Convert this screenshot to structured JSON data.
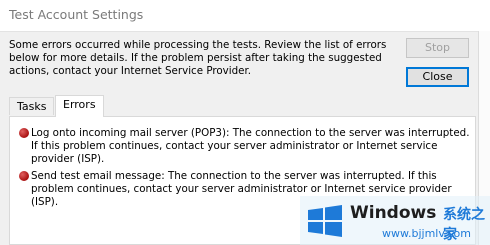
{
  "window": {
    "title": "Test Account Settings"
  },
  "message": "Some errors occurred while processing the tests. Review the list of errors below for more details. If the problem persist after taking the suggested actions, contact your Internet Service Provider.",
  "buttons": {
    "stop": "Stop",
    "close": "Close"
  },
  "tabs": [
    {
      "label": "Tasks",
      "active": false
    },
    {
      "label": "Errors",
      "active": true
    }
  ],
  "errors": [
    {
      "text": "Log onto incoming mail server (POP3): The connection to the server was interrupted. If this problem continues, contact your server administrator or Internet service provider (ISP)."
    },
    {
      "text": "Send test email message: The connection to the server was interrupted. If this problem continues, contact your server administrator or Internet service provider (ISP)."
    }
  ],
  "watermark": {
    "brand": "Windows",
    "cn": "系统之家",
    "url": "www.bjjmlv.com"
  },
  "colors": {
    "accent": "#0078d7",
    "error": "#b01818",
    "watermark_blue": "#1e7ad8"
  }
}
